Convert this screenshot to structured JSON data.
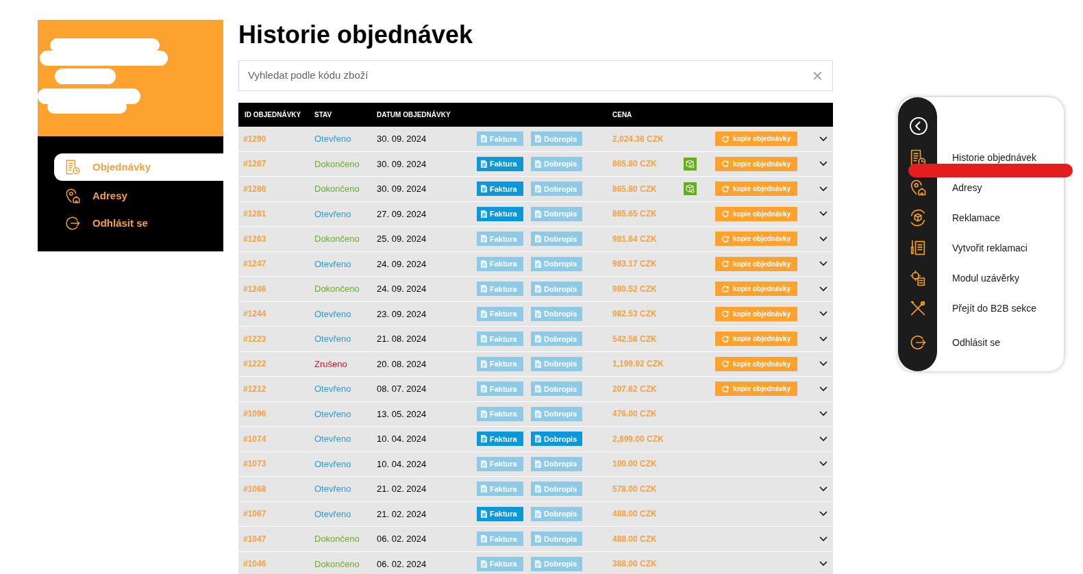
{
  "sidebar": {
    "items": [
      {
        "label": "Objednávky",
        "selected": true
      },
      {
        "label": "Adresy",
        "selected": false
      },
      {
        "label": "Odhlásit se",
        "selected": false
      }
    ]
  },
  "title": "Historie objednávek",
  "search": {
    "placeholder": "Vyhledat podle kódu zboží",
    "clear": "✕"
  },
  "table": {
    "columns": [
      "ID OBJEDNÁVKY",
      "STAV",
      "DATUM OBJEDNÁVKY",
      "CENA"
    ],
    "rows": [
      {
        "id": "#1290",
        "status": "Otevřeno",
        "color": "#2d9ad6",
        "date": "30. 09. 2024",
        "invoice": {
          "label": "Faktura",
          "active": false
        },
        "credit": {
          "label": "Dobropis",
          "active": false
        },
        "price": "2,024.36 CZK",
        "package": false,
        "copy": "kopie objednávky"
      },
      {
        "id": "#1287",
        "status": "Dokončeno",
        "color": "#6aab2e",
        "date": "30. 09. 2024",
        "invoice": {
          "label": "Faktura",
          "active": true
        },
        "credit": {
          "label": "Dobropis",
          "active": false
        },
        "price": "865.80 CZK",
        "package": true,
        "copy": "kopie objednávky"
      },
      {
        "id": "#1286",
        "status": "Dokončeno",
        "color": "#6aab2e",
        "date": "30. 09. 2024",
        "invoice": {
          "label": "Faktura",
          "active": true
        },
        "credit": {
          "label": "Dobropis",
          "active": false
        },
        "price": "865.80 CZK",
        "package": true,
        "copy": "kopie objednávky"
      },
      {
        "id": "#1281",
        "status": "Otevřeno",
        "color": "#2d9ad6",
        "date": "27. 09. 2024",
        "invoice": {
          "label": "Faktura",
          "active": true
        },
        "credit": {
          "label": "Dobropis",
          "active": false
        },
        "price": "865.65 CZK",
        "package": false,
        "copy": "kopie objednávky"
      },
      {
        "id": "#1263",
        "status": "Dokončeno",
        "color": "#6aab2e",
        "date": "25. 09. 2024",
        "invoice": {
          "label": "Faktura",
          "active": false
        },
        "credit": {
          "label": "Dobropis",
          "active": false
        },
        "price": "981.64 CZK",
        "package": false,
        "copy": "kopie objednávky"
      },
      {
        "id": "#1247",
        "status": "Otevřeno",
        "color": "#2d9ad6",
        "date": "24. 09. 2024",
        "invoice": {
          "label": "Faktura",
          "active": false
        },
        "credit": {
          "label": "Dobropis",
          "active": false
        },
        "price": "983.17 CZK",
        "package": false,
        "copy": "kopie objednávky"
      },
      {
        "id": "#1246",
        "status": "Dokončeno",
        "color": "#6aab2e",
        "date": "24. 09. 2024",
        "invoice": {
          "label": "Faktura",
          "active": false
        },
        "credit": {
          "label": "Dobropis",
          "active": false
        },
        "price": "980.52 CZK",
        "package": false,
        "copy": "kopie objednávky"
      },
      {
        "id": "#1244",
        "status": "Otevřeno",
        "color": "#2d9ad6",
        "date": "23. 09. 2024",
        "invoice": {
          "label": "Faktura",
          "active": false
        },
        "credit": {
          "label": "Dobropis",
          "active": false
        },
        "price": "982.53 CZK",
        "package": false,
        "copy": "kopie objednávky"
      },
      {
        "id": "#1223",
        "status": "Otevřeno",
        "color": "#2d9ad6",
        "date": "21. 08. 2024",
        "invoice": {
          "label": "Faktura",
          "active": false
        },
        "credit": {
          "label": "Dobropis",
          "active": false
        },
        "price": "542.58 CZK",
        "package": false,
        "copy": "kopie objednávky"
      },
      {
        "id": "#1222",
        "status": "Zrušeno",
        "color": "#d0142c",
        "date": "20. 08. 2024",
        "invoice": {
          "label": "Faktura",
          "active": false
        },
        "credit": {
          "label": "Dobropis",
          "active": false
        },
        "price": "1,199.92 CZK",
        "package": false,
        "copy": "kopie objednávky"
      },
      {
        "id": "#1212",
        "status": "Otevřeno",
        "color": "#2d9ad6",
        "date": "08. 07. 2024",
        "invoice": {
          "label": "Faktura",
          "active": false
        },
        "credit": {
          "label": "Dobropis",
          "active": false
        },
        "price": "207.62 CZK",
        "package": false,
        "copy": "kopie objednávky"
      },
      {
        "id": "#1096",
        "status": "Otevřeno",
        "color": "#2d9ad6",
        "date": "13. 05. 2024",
        "invoice": {
          "label": "Faktura",
          "active": false
        },
        "credit": {
          "label": "Dobropis",
          "active": false
        },
        "price": "476.00 CZK",
        "package": false
      },
      {
        "id": "#1074",
        "status": "Otevřeno",
        "color": "#2d9ad6",
        "date": "10. 04. 2024",
        "invoice": {
          "label": "Faktura",
          "active": true
        },
        "credit": {
          "label": "Dobropis",
          "active": true
        },
        "price": "2,899.00 CZK",
        "package": false
      },
      {
        "id": "#1073",
        "status": "Otevřeno",
        "color": "#2d9ad6",
        "date": "10. 04. 2024",
        "invoice": {
          "label": "Faktura",
          "active": false
        },
        "credit": {
          "label": "Dobropis",
          "active": false
        },
        "price": "100.00 CZK",
        "package": false
      },
      {
        "id": "#1068",
        "status": "Otevřeno",
        "color": "#2d9ad6",
        "date": "21. 02. 2024",
        "invoice": {
          "label": "Faktura",
          "active": false
        },
        "credit": {
          "label": "Dobropis",
          "active": false
        },
        "price": "578.00 CZK",
        "package": false
      },
      {
        "id": "#1067",
        "status": "Otevřeno",
        "color": "#2d9ad6",
        "date": "21. 02. 2024",
        "invoice": {
          "label": "Faktura",
          "active": true
        },
        "credit": {
          "label": "Dobropis",
          "active": false
        },
        "price": "488.00 CZK",
        "package": false
      },
      {
        "id": "#1047",
        "status": "Dokončeno",
        "color": "#6aab2e",
        "date": "06. 02. 2024",
        "invoice": {
          "label": "Faktura",
          "active": false
        },
        "credit": {
          "label": "Dobropis",
          "active": false
        },
        "price": "488.00 CZK",
        "package": false
      },
      {
        "id": "#1046",
        "status": "Dokončeno",
        "color": "#6aab2e",
        "date": "06. 02. 2024",
        "invoice": {
          "label": "Faktura",
          "active": false
        },
        "credit": {
          "label": "Dobropis",
          "active": false
        },
        "price": "388.00 CZK",
        "package": false
      }
    ]
  },
  "popup_menu": {
    "items": [
      {
        "label": "Historie objednávek"
      },
      {
        "label": "Adresy"
      },
      {
        "label": "Reklamace"
      },
      {
        "label": "Vytvořit reklamaci"
      },
      {
        "label": "Modul uzávěrky"
      },
      {
        "label": "Přejít do B2B sekce"
      },
      {
        "label": "Odhlásit se"
      }
    ]
  }
}
